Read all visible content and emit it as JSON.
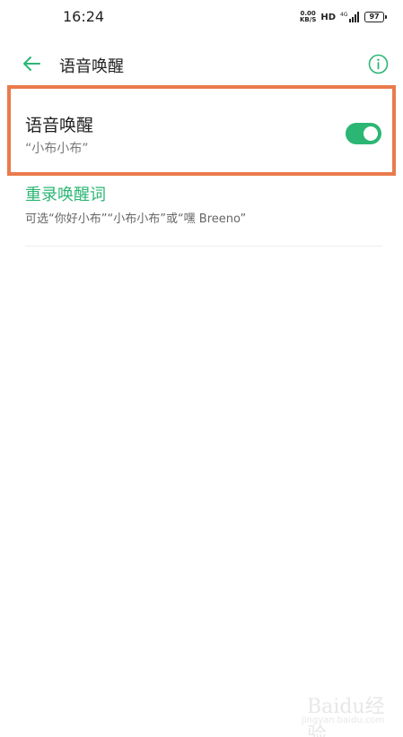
{
  "status_bar": {
    "time": "16:24",
    "net_speed_value": "0.00",
    "net_speed_unit": "KB/S",
    "hd": "HD",
    "battery": "97"
  },
  "header": {
    "title": "语音唤醒",
    "back_icon": "arrow-left-icon",
    "info_icon": "info-circle-icon"
  },
  "voice_wake": {
    "title": "语音唤醒",
    "subtitle": "“小布小布”",
    "enabled": true,
    "toggle_color": "#2bb673"
  },
  "rerecord": {
    "title": "重录唤醒词",
    "subtitle": "可选“你好小布”“小布小布”或“嘿 Breeno”"
  },
  "highlight_color": "#ea7a4b",
  "accent_color": "#2bb673",
  "watermark": {
    "brand": "Baidu经验",
    "url": "jingyan.baidu.com"
  }
}
